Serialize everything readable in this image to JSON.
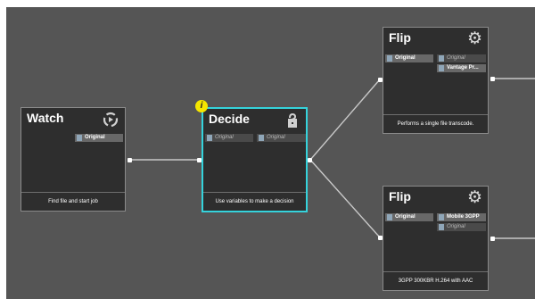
{
  "nodes": {
    "watch": {
      "title": "Watch",
      "port_original": "Original",
      "footer": "Find file and start job"
    },
    "decide": {
      "title": "Decide",
      "info_badge": "i",
      "port_original_1": "Original",
      "port_original_2": "Original",
      "footer": "Use variables to make a decision"
    },
    "flip_top": {
      "title": "Flip",
      "port_original_left": "Original",
      "port_original_right": "Original",
      "port_vantage": "Vantage Pr...",
      "footer": "Performs a single file transcode."
    },
    "flip_bottom": {
      "title": "Flip",
      "port_original_left": "Original",
      "port_mobile": "Mobile 3GPP",
      "port_original_right": "Original",
      "footer": "3GPP 300KBR H.264 with AAC"
    }
  },
  "colors": {
    "canvas": "#555555",
    "node": "#2e2e2e",
    "selected_border": "#35d3dc",
    "info_badge": "#f5e600",
    "wire": "#c8c8c8"
  },
  "icons": {
    "watch": "circular-arrows-icon",
    "decide": "question-decision-icon",
    "flip": "gear-icon"
  }
}
